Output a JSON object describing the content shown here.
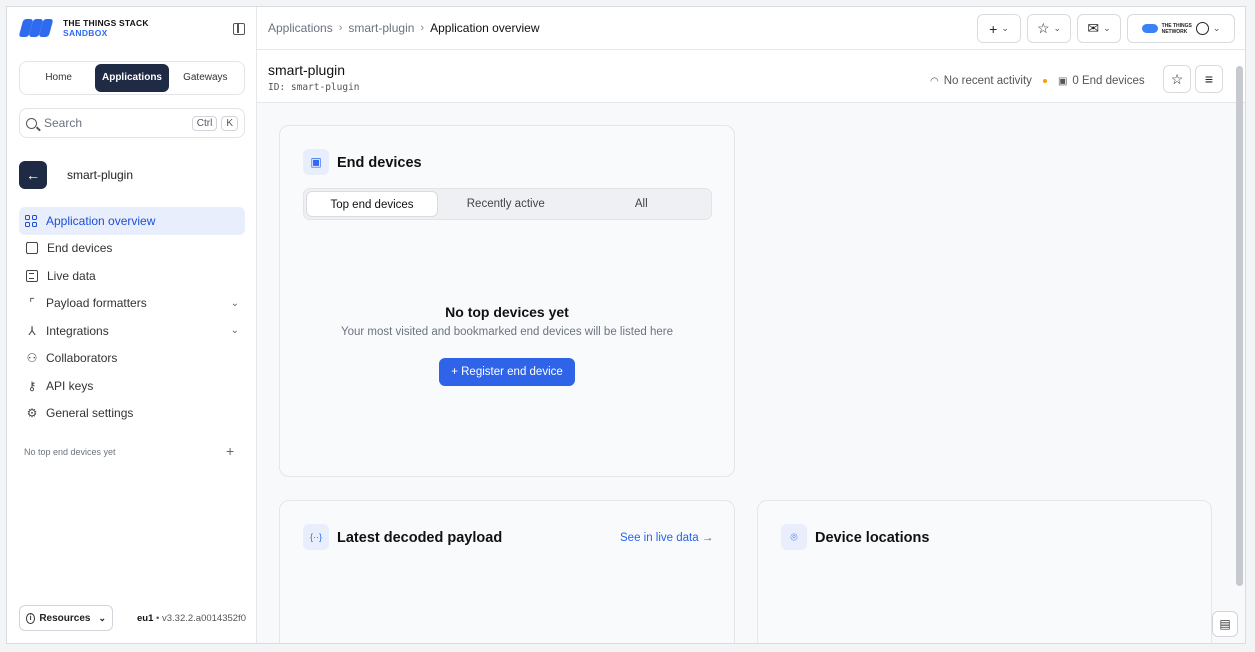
{
  "brand": {
    "line1": "THE THINGS STACK",
    "line2": "SANDBOX"
  },
  "switcher": [
    "Home",
    "Applications",
    "Gateways"
  ],
  "search": {
    "placeholder": "Search",
    "key1": "Ctrl",
    "key2": "K"
  },
  "app": {
    "name": "smart-plugin",
    "back_glyph": "←"
  },
  "nav": [
    {
      "label": "Application overview",
      "active": true
    },
    {
      "label": "End devices"
    },
    {
      "label": "Live data"
    },
    {
      "label": "Payload formatters",
      "expandable": true
    },
    {
      "label": "Integrations",
      "expandable": true
    },
    {
      "label": "Collaborators"
    },
    {
      "label": "API keys"
    },
    {
      "label": "General settings"
    }
  ],
  "sidebar_footer": {
    "empty_devices": "No top end devices yet",
    "resources": "Resources",
    "region": "eu1",
    "version": "v3.32.2.a0014352f0"
  },
  "breadcrumb": [
    "Applications",
    "smart-plugin",
    "Application overview"
  ],
  "topbar": {
    "network_line1": "THE THINGS",
    "network_line2": "NETWORK"
  },
  "header": {
    "title": "smart-plugin",
    "id_text": "ID: smart-plugin",
    "activity": "No recent activity",
    "devices": "0 End devices"
  },
  "end_devices_card": {
    "title": "End devices",
    "tabs": [
      "Top end devices",
      "Recently active",
      "All"
    ],
    "empty_title": "No top devices yet",
    "empty_sub": "Your most visited and bookmarked end devices will be listed here",
    "register": "+ Register end device"
  },
  "payload_card": {
    "title": "Latest decoded payload",
    "link": "See in live data →",
    "icon": "{··}"
  },
  "location_card": {
    "title": "Device locations"
  },
  "colors": {
    "accent": "#2f63e8",
    "dark": "#1f2a44",
    "activity_dot": "#f59e0b"
  }
}
